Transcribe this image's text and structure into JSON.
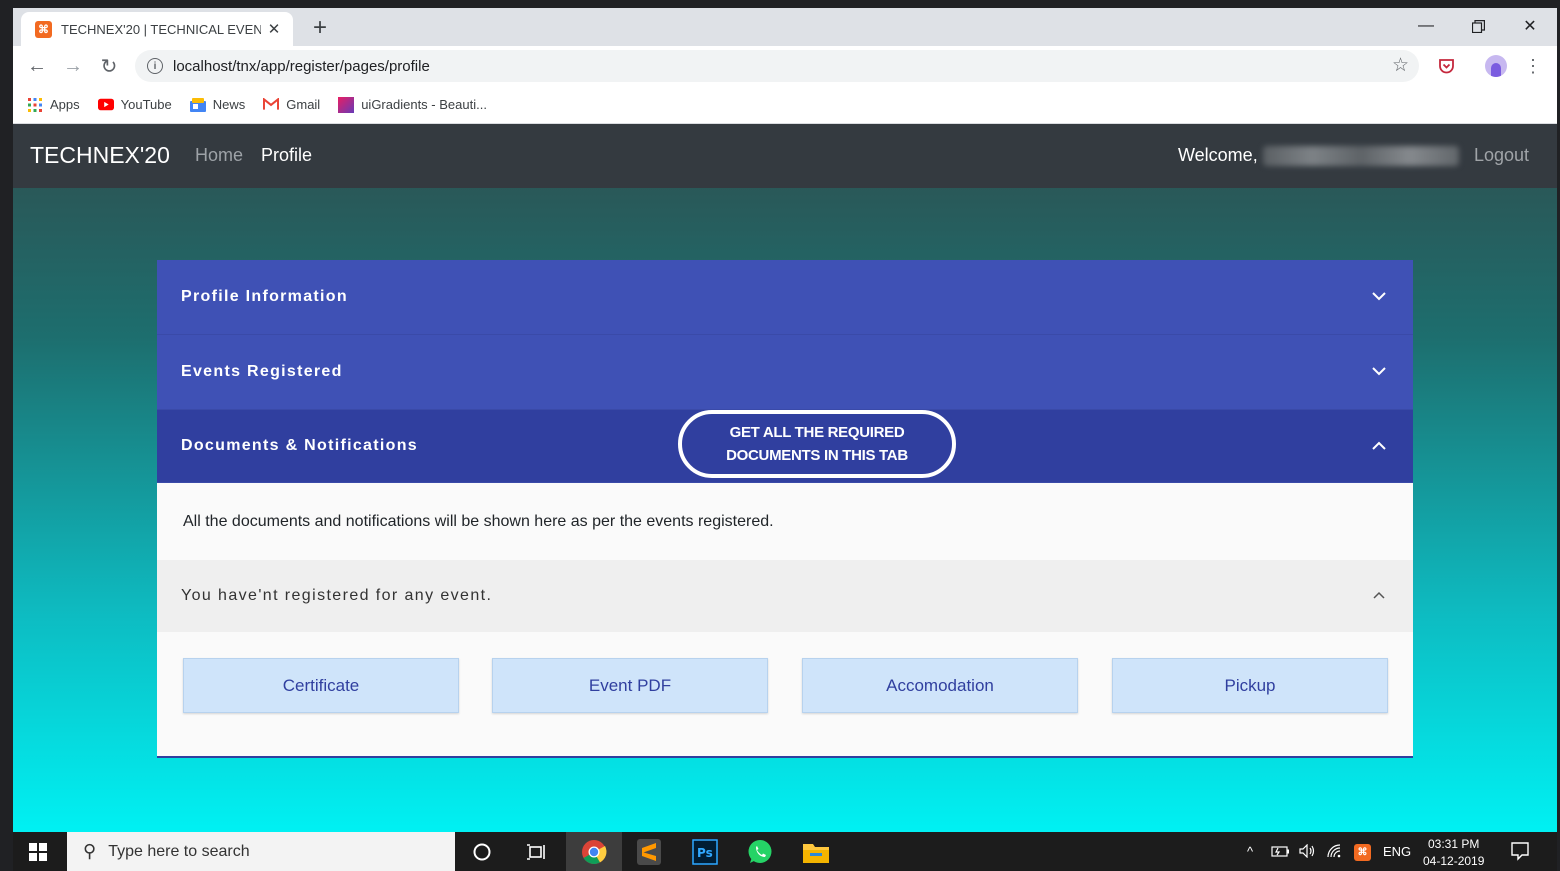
{
  "browser": {
    "tab_title": "TECHNEX'20 | TECHNICAL EVENT",
    "tab_favicon": "⌘",
    "url": "localhost/tnx/app/register/pages/profile",
    "bookmarks": [
      {
        "label": "Apps",
        "icon": "apps-grid-icon"
      },
      {
        "label": "YouTube",
        "icon": "youtube-icon"
      },
      {
        "label": "News",
        "icon": "news-icon"
      },
      {
        "label": "Gmail",
        "icon": "gmail-icon"
      },
      {
        "label": "uiGradients - Beauti...",
        "icon": "uigradients-icon"
      }
    ]
  },
  "navbar": {
    "brand": "TECHNEX'20",
    "links": [
      {
        "label": "Home"
      },
      {
        "label": "Profile"
      }
    ],
    "welcome": "Welcome,",
    "logout": "Logout"
  },
  "accordion": {
    "sections": [
      {
        "title": "Profile Information",
        "expanded": false
      },
      {
        "title": "Events Registered",
        "expanded": false
      },
      {
        "title": "Documents & Notifications",
        "expanded": true
      }
    ],
    "callout": {
      "line1": "GET ALL THE REQUIRED",
      "line2": "DOCUMENTS IN THIS TAB"
    },
    "body_text": "All the documents and notifications will be shown here as per the events registered.",
    "sub_panel_title": "You have'nt registered for any event.",
    "doc_buttons": [
      {
        "label": "Certificate"
      },
      {
        "label": "Event PDF"
      },
      {
        "label": "Accomodation"
      },
      {
        "label": "Pickup"
      }
    ]
  },
  "taskbar": {
    "search_placeholder": "Type here to search",
    "tray_lang": "ENG",
    "time": "03:31 PM",
    "date": "04-12-2019"
  },
  "colors": {
    "accordion_header": "#3f51b5",
    "accordion_active": "#303f9f",
    "button_bg": "#cfe4fa",
    "navbar_bg": "#343a40"
  }
}
